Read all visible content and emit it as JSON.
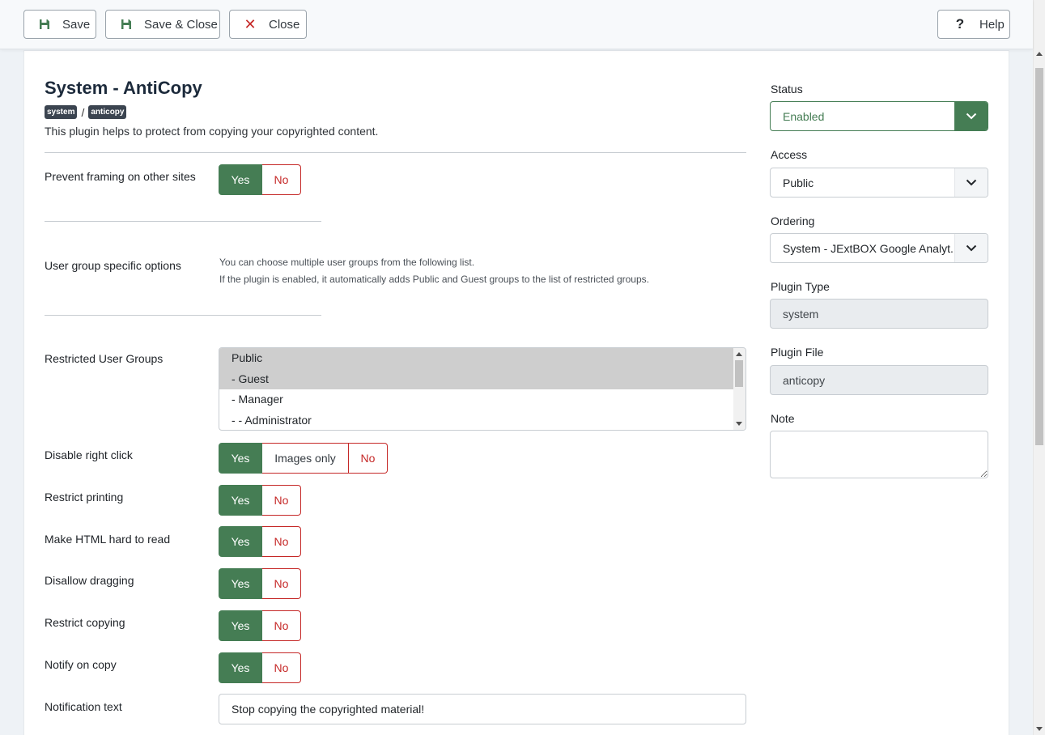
{
  "toolbar": {
    "save_label": "Save",
    "save_close_label": "Save & Close",
    "close_label": "Close",
    "help_label": "Help"
  },
  "header": {
    "title": "System - AntiCopy",
    "badges": [
      "system",
      "anticopy"
    ],
    "separator": "/",
    "description": "This plugin helps to protect from copying your copyrighted content."
  },
  "form": {
    "prevent_framing": {
      "label": "Prevent framing on other sites",
      "yes": "Yes",
      "no": "No",
      "value": "Yes"
    },
    "user_group_options": {
      "label": "User group specific options",
      "help_line1": "You can choose multiple user groups from the following list.",
      "help_line2": "If the plugin is enabled, it automatically adds Public and Guest groups to the list of restricted groups."
    },
    "restricted_groups": {
      "label": "Restricted User Groups",
      "options": [
        {
          "text": "Public",
          "selected": true
        },
        {
          "text": "- Guest",
          "selected": true
        },
        {
          "text": "- Manager",
          "selected": false
        },
        {
          "text": "- - Administrator",
          "selected": false
        }
      ]
    },
    "disable_right_click": {
      "label": "Disable right click",
      "yes": "Yes",
      "mid": "Images only",
      "no": "No",
      "value": "Yes"
    },
    "restrict_printing": {
      "label": "Restrict printing",
      "yes": "Yes",
      "no": "No",
      "value": "Yes"
    },
    "make_html_hard": {
      "label": "Make HTML hard to read",
      "yes": "Yes",
      "no": "No",
      "value": "Yes"
    },
    "disallow_dragging": {
      "label": "Disallow dragging",
      "yes": "Yes",
      "no": "No",
      "value": "Yes"
    },
    "restrict_copying": {
      "label": "Restrict copying",
      "yes": "Yes",
      "no": "No",
      "value": "Yes"
    },
    "notify_on_copy": {
      "label": "Notify on copy",
      "yes": "Yes",
      "no": "No",
      "value": "Yes"
    },
    "notification_text": {
      "label": "Notification text",
      "value": "Stop copying the copyrighted material!"
    }
  },
  "sidebar": {
    "status": {
      "label": "Status",
      "value": "Enabled"
    },
    "access": {
      "label": "Access",
      "value": "Public"
    },
    "ordering": {
      "label": "Ordering",
      "value": "System - JExtBOX Google Analyt."
    },
    "plugin_type": {
      "label": "Plugin Type",
      "value": "system"
    },
    "plugin_file": {
      "label": "Plugin File",
      "value": "anticopy"
    },
    "note": {
      "label": "Note",
      "value": ""
    }
  },
  "colors": {
    "accent_green": "#457d54",
    "danger_red": "#c52827",
    "heading": "#1c2a3b"
  }
}
